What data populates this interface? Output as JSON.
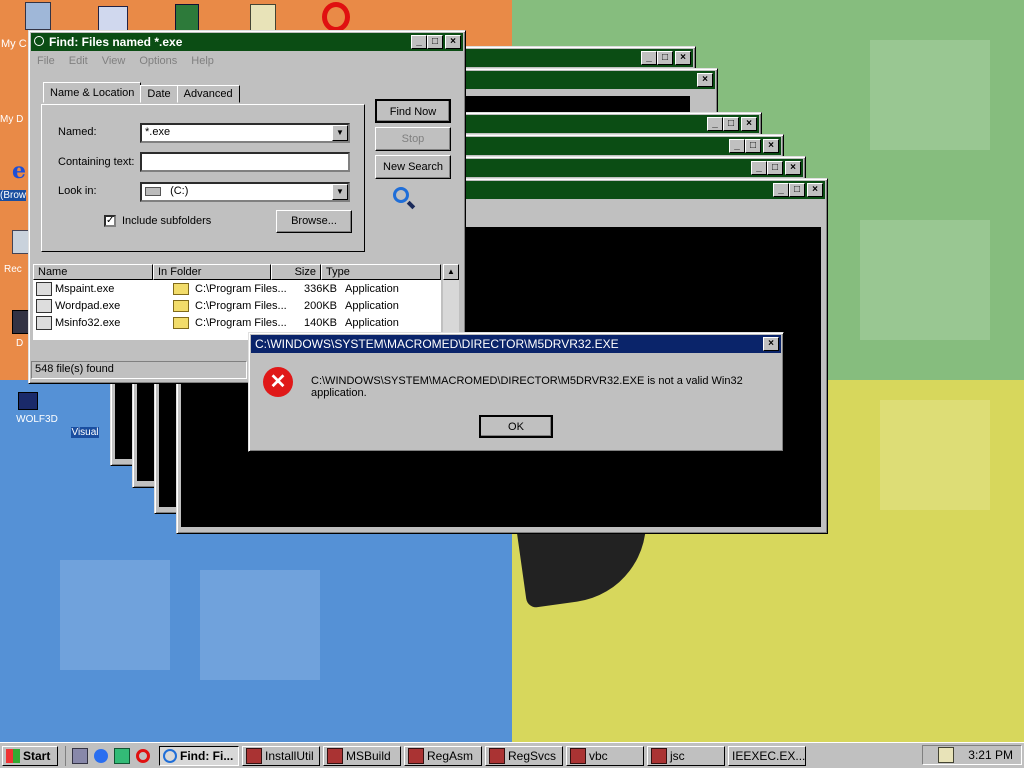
{
  "desktop": {
    "icons": [
      {
        "label": "My C",
        "icon": "my-computer-icon"
      },
      {
        "label": "My D",
        "icon": "my-documents-icon"
      },
      {
        "label": "(Brow",
        "icon": "internet-explorer-icon"
      },
      {
        "label": "Rec",
        "icon": "recycle-bin-icon"
      },
      {
        "label": "D",
        "icon": "program-icon"
      },
      {
        "label": "WOLF3D",
        "icon": "wolf3d-icon"
      },
      {
        "label": "Visual",
        "icon": "visual-studio-icon"
      }
    ],
    "top_icons": [
      "network-icon",
      "excel-icon",
      "scheduler-icon",
      "opera-icon"
    ]
  },
  "find_window": {
    "title": "Find: Files named *.exe",
    "menu": [
      "File",
      "Edit",
      "View",
      "Options",
      "Help"
    ],
    "tabs": [
      "Name & Location",
      "Date",
      "Advanced"
    ],
    "named_label": "Named:",
    "named_value": "*.exe",
    "containing_label": "Containing text:",
    "containing_value": "",
    "lookin_label": "Look in:",
    "lookin_value": "(C:)",
    "subfolders_label": "Include subfolders",
    "subfolders_checked": true,
    "browse_label": "Browse...",
    "find_now_label": "Find Now",
    "stop_label": "Stop",
    "new_search_label": "New Search",
    "columns": [
      "Name",
      "In Folder",
      "Size",
      "Type"
    ],
    "rows": [
      {
        "name": "Mspaint.exe",
        "folder": "C:\\Program Files...",
        "size": "336KB",
        "type": "Application"
      },
      {
        "name": "Wordpad.exe",
        "folder": "C:\\Program Files...",
        "size": "200KB",
        "type": "Application"
      },
      {
        "name": "Msinfo32.exe",
        "folder": "C:\\Program Files...",
        "size": "140KB",
        "type": "Application"
      }
    ],
    "status": "548 file(s) found"
  },
  "error_dialog": {
    "title": "C:\\WINDOWS\\SYSTEM\\MACROMED\\DIRECTOR\\M5DRVR32.EXE",
    "message": "C:\\WINDOWS\\SYSTEM\\MACROMED\\DIRECTOR\\M5DRVR32.EXE is not a valid Win32 application.",
    "ok_label": "OK"
  },
  "taskbar": {
    "start_label": "Start",
    "quick_launch": [
      "show-desktop-icon",
      "internet-explorer-icon",
      "outlook-icon",
      "opera-icon"
    ],
    "items": [
      {
        "label": "Find: Fi...",
        "active": true
      },
      {
        "label": "InstallUtil",
        "active": false
      },
      {
        "label": "MSBuild",
        "active": false
      },
      {
        "label": "RegAsm",
        "active": false
      },
      {
        "label": "RegSvcs",
        "active": false
      },
      {
        "label": "vbc",
        "active": false
      },
      {
        "label": "jsc",
        "active": false
      },
      {
        "label": "IEEXEC.EX...",
        "active": false
      }
    ],
    "clock": "3:21 PM"
  },
  "colors": {
    "titlebar": "#0b4d14",
    "dialog_titlebar": "#0a246a",
    "window_face": "#c0c0c0"
  }
}
